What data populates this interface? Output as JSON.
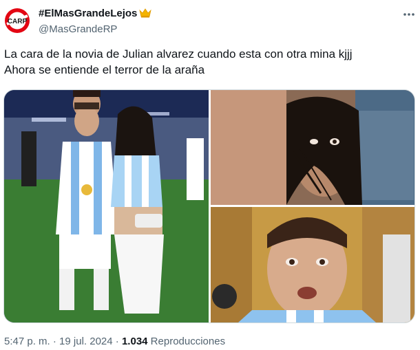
{
  "author": {
    "display_name": "#ElMasGrandeLejos",
    "badge_icon": "crown-icon",
    "handle": "@MasGrandeRP",
    "avatar_icon": "river-plate-crest-icon",
    "avatar_letters": "CARP"
  },
  "tweet": {
    "line1": "La cara de la novia de Julian alvarez cuando esta con otra mina kjjj",
    "line2": "Ahora se entiende el terror de la araña"
  },
  "media": {
    "photos": [
      "photo-couple-stadium",
      "photo-woman-closeup",
      "photo-man-closeup"
    ]
  },
  "meta": {
    "time": "5:47 p. m.",
    "sep1": " · ",
    "date": "19 jul. 2024",
    "sep2": " · ",
    "views": "1.034",
    "views_label": " Reproducciones"
  },
  "colors": {
    "text_primary": "#0f1419",
    "text_secondary": "#536471",
    "border": "#cfd9de",
    "crest_red": "#e30613",
    "crown_gold": "#f4b400"
  }
}
